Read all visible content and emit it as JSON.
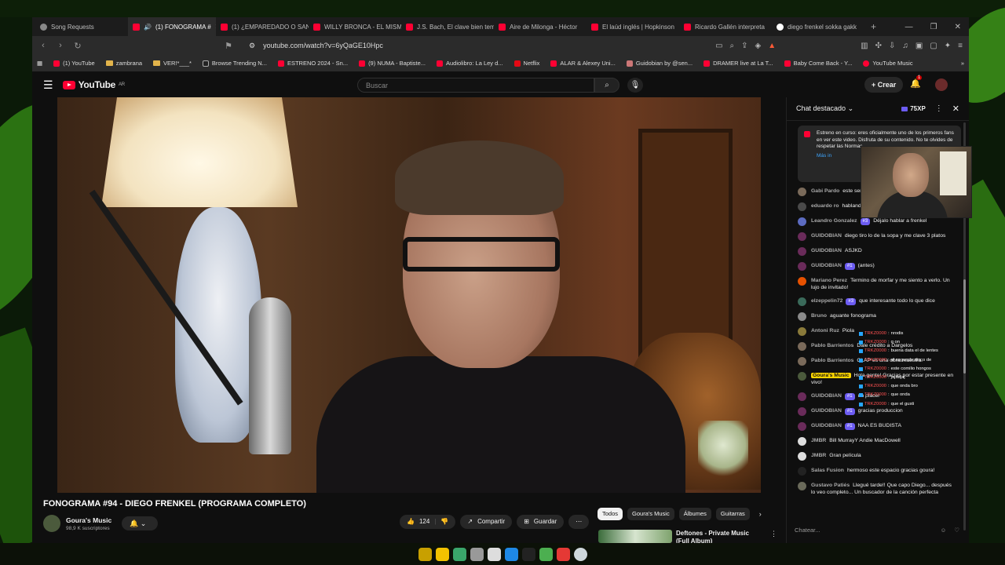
{
  "tabs": [
    {
      "label": "Song Requests",
      "icon": "gray",
      "active": false
    },
    {
      "label": "(1) FONOGRAMA #",
      "icon": "yt",
      "active": true
    },
    {
      "label": "(1) ¿EMPAREDADO O SAN",
      "icon": "yt",
      "active": false
    },
    {
      "label": "WILLY BRONCA - EL MISM",
      "icon": "yt",
      "active": false
    },
    {
      "label": "J.S. Bach, El clave bien tem",
      "icon": "yt",
      "active": false
    },
    {
      "label": "Aire de Milonga - Héctor",
      "icon": "yt",
      "active": false
    },
    {
      "label": "El laúd inglés | Hopkinson",
      "icon": "yt",
      "active": false
    },
    {
      "label": "Ricardo Gallén interpreta",
      "icon": "yt",
      "active": false
    },
    {
      "label": "diego frenkel sokka gakk",
      "icon": "google",
      "active": false
    }
  ],
  "address": {
    "url": "youtube.com/watch?v=6yQaGE10Hpc"
  },
  "bookmarks": [
    {
      "label": "(1) YouTube",
      "type": "yt"
    },
    {
      "label": "zambrana",
      "type": "folder"
    },
    {
      "label": "VER!*___*",
      "type": "folder"
    },
    {
      "label": "Browse Trending N...",
      "type": "site"
    },
    {
      "label": "ESTRENO 2024 - Sn...",
      "type": "yt"
    },
    {
      "label": "(9) NUMA - Baptiste...",
      "type": "yt"
    },
    {
      "label": "Audiolibro: La Ley d...",
      "type": "yt"
    },
    {
      "label": "Netflix",
      "type": "yt"
    },
    {
      "label": "ALAR & Alexey Uni...",
      "type": "yt"
    },
    {
      "label": "Guidobian by @sen...",
      "type": "site"
    },
    {
      "label": "DRAMER live at La T...",
      "type": "yt"
    },
    {
      "label": "Baby Come Back - Y...",
      "type": "yt"
    },
    {
      "label": "YouTube Music",
      "type": "yt"
    }
  ],
  "header": {
    "logo": "YouTube",
    "region": "AR",
    "search_placeholder": "Buscar",
    "create_label": "Crear",
    "notif_count": "1"
  },
  "video": {
    "title": "FONOGRAMA #94 - DIEGO FRENKEL (PROGRAMA COMPLETO)",
    "channel": "Goura's Music",
    "subscribers": "98,9 K suscriptores",
    "likes": "124",
    "share_label": "Compartir",
    "save_label": "Guardar"
  },
  "chips": [
    "Todos",
    "Goura's Music",
    "Álbumes",
    "Guitarras"
  ],
  "recommended": {
    "title": "Deftones - Private Music (Full Album)"
  },
  "chat": {
    "header": "Chat destacado",
    "xp": "75XP",
    "pinned": "Estreno en curso: eres oficialmente uno de los primeros fans en ver este video. Disfruta de su contenido. No te olvides de respetar las Normas.",
    "pinned_more": "Más in",
    "input_placeholder": "Chatear...",
    "messages": [
      {
        "author": "Gabi Pardo",
        "badge": "",
        "text": "este señor",
        "color": "#7a6a5a"
      },
      {
        "author": "eduardo ro",
        "badge": "",
        "text": "hablando",
        "color": "#4a4a4a"
      },
      {
        "author": "Leandro Gonzalez",
        "badge": "#3",
        "text": "Déjalo hablar a frenkel",
        "color": "#5c6bc0"
      },
      {
        "author": "GUIDOBIAN",
        "badge": "",
        "text": "diego tiro lo de la sopa y me clave 3 platos",
        "color": "#6a2b5a"
      },
      {
        "author": "GUIDOBIAN",
        "badge": "",
        "text": "ASJKD",
        "color": "#6a2b5a"
      },
      {
        "author": "GUIDOBIAN",
        "badge": "#1",
        "text": "(antes)",
        "color": "#6a2b5a"
      },
      {
        "author": "Mariano Perez",
        "badge": "",
        "text": "Termino de morfar y me siento a verlo. Un lujo de invitado!",
        "color": "#e65100"
      },
      {
        "author": "elzeppelin72",
        "badge": "#3",
        "text": "que interesante todo lo que dice",
        "color": "#3a6a5a"
      },
      {
        "author": "Bruno",
        "badge": "",
        "text": "aguante fonograma",
        "color": "#8a8a8a"
      },
      {
        "author": "Antoni Ruz",
        "badge": "",
        "text": "Piola",
        "color": "#8a7a3a"
      },
      {
        "author": "Pablo Barrientos",
        "badge": "",
        "text": "Dale crédito a Dargelos",
        "color": "#7a6a5a"
      },
      {
        "author": "Pablo Barrientos",
        "badge": "",
        "text": "CLAP es una obra maestra.",
        "color": "#7a6a5a"
      },
      {
        "author": "Goura's Music",
        "badge": "",
        "text": "Hola gente! Gracias por estar presente en vivo!",
        "color": "#4b5a3c",
        "owner": true
      },
      {
        "author": "GUIDOBIAN",
        "badge": "#1",
        "text": "un placer",
        "color": "#6a2b5a"
      },
      {
        "author": "GUIDOBIAN",
        "badge": "#1",
        "text": "gracias produccion",
        "color": "#6a2b5a"
      },
      {
        "author": "GUIDOBIAN",
        "badge": "#1",
        "text": "NAA ES BUDISTA",
        "color": "#6a2b5a"
      },
      {
        "author": "JMBR",
        "badge": "",
        "text": "Bill MurrayY Andie MacDowell",
        "color": "#dddddd"
      },
      {
        "author": "JMBR",
        "badge": "",
        "text": "Gran película",
        "color": "#dddddd"
      },
      {
        "author": "Salas Fusion",
        "badge": "",
        "text": "hermoso este espacio gracias goura!",
        "color": "#222222"
      },
      {
        "author": "Gustavo Patiés",
        "badge": "",
        "text": "Llegué tarde!! Que capo Diego... después lo veo completo... Un buscador de la canción perfecta",
        "color": "#6a6a5a"
      }
    ]
  },
  "overlay_chat": [
    {
      "user": "TRKZ0000",
      "text": "nrodis"
    },
    {
      "user": "TRKZ0000",
      "text": "q on"
    },
    {
      "user": "TRKZ0000",
      "text": "buena data el de lentes"
    },
    {
      "user": "TRKZ0000",
      "text": "el segundo disco de"
    },
    {
      "user": "TRKZ0000",
      "text": "este comilio hongos"
    },
    {
      "user": "TRKZ0000",
      "text": "jajaajaj"
    },
    {
      "user": "TRKZ0000",
      "text": "que onda bro"
    },
    {
      "user": "TRKZ0000",
      "text": "que onda"
    },
    {
      "user": "TRKZ0000",
      "text": "que el gusti"
    }
  ]
}
